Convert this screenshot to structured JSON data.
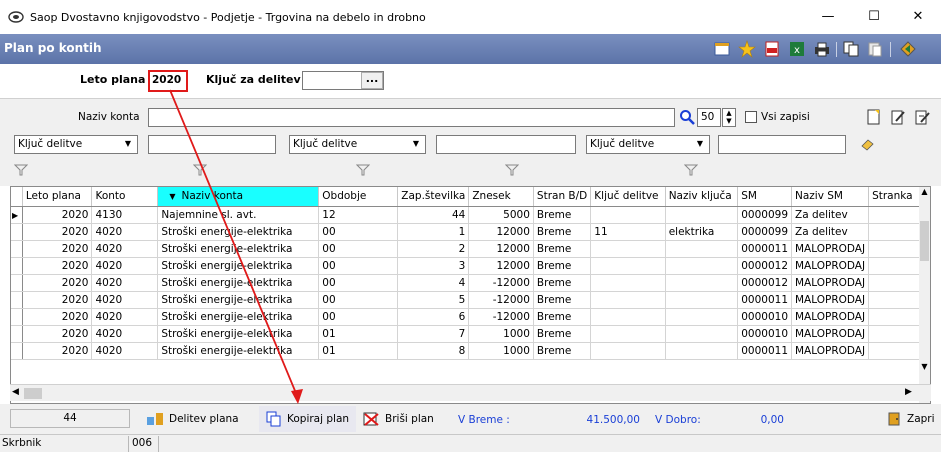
{
  "window": {
    "title": "Saop Dvostavno knjigovodstvo - Podjetje - Trgovina na debelo in drobno",
    "minimize": "—",
    "maximize": "☐",
    "close": "✕"
  },
  "header": {
    "title": "Plan po kontih"
  },
  "form": {
    "leto_plana_label": "Leto plana",
    "leto_plana_value": "2020",
    "kljuc_label": "Ključ za delitev",
    "kljuc_value": "",
    "ellipsis": "..."
  },
  "filter": {
    "naziv_konta_label": "Naziv konta",
    "naziv_konta_value": "",
    "count_value": "50",
    "vsi_zapisi_label": "Vsi zapisi",
    "kljuc1": "Ključ delitve",
    "kljuc2": "Ključ delitve",
    "kljuc3": "Ključ delitve"
  },
  "table": {
    "columns": [
      "Leto plana",
      "Konto",
      "Naziv konta",
      "Obdobje",
      "Zap.številka",
      "Znesek",
      "Stran B/D",
      "Ključ delitve",
      "Naziv ključa",
      "SM",
      "Naziv SM",
      "Stranka"
    ],
    "rows": [
      [
        "2020",
        "4130",
        "Najemnine sl. avt.",
        "12",
        "44",
        "5000",
        "Breme",
        "",
        "",
        "0000099",
        "Za delitev",
        ""
      ],
      [
        "2020",
        "4020",
        "Stroški energije-elektrika",
        "00",
        "1",
        "12000",
        "Breme",
        "11",
        "elektrika",
        "0000099",
        "Za delitev",
        ""
      ],
      [
        "2020",
        "4020",
        "Stroški energije-elektrika",
        "00",
        "2",
        "12000",
        "Breme",
        "",
        "",
        "0000011",
        "MALOPRODAJ",
        ""
      ],
      [
        "2020",
        "4020",
        "Stroški energije-elektrika",
        "00",
        "3",
        "12000",
        "Breme",
        "",
        "",
        "0000012",
        "MALOPRODAJ",
        ""
      ],
      [
        "2020",
        "4020",
        "Stroški energije-elektrika",
        "00",
        "4",
        "-12000",
        "Breme",
        "",
        "",
        "0000012",
        "MALOPRODAJ",
        ""
      ],
      [
        "2020",
        "4020",
        "Stroški energije-elektrika",
        "00",
        "5",
        "-12000",
        "Breme",
        "",
        "",
        "0000011",
        "MALOPRODAJ",
        ""
      ],
      [
        "2020",
        "4020",
        "Stroški energije-elektrika",
        "00",
        "6",
        "-12000",
        "Breme",
        "",
        "",
        "0000010",
        "MALOPRODAJ",
        ""
      ],
      [
        "2020",
        "4020",
        "Stroški energije-elektrika",
        "01",
        "7",
        "1000",
        "Breme",
        "",
        "",
        "0000010",
        "MALOPRODAJ",
        ""
      ],
      [
        "2020",
        "4020",
        "Stroški energije-elektrika",
        "01",
        "8",
        "1000",
        "Breme",
        "",
        "",
        "0000011",
        "MALOPRODAJ",
        ""
      ]
    ]
  },
  "bottom": {
    "count": "44",
    "delitev_plana": "Delitev plana",
    "kopiraj_plan": "Kopiraj plan",
    "brisi_plan": "Briši plan",
    "v_breme_label": "V Breme :",
    "v_breme_value": "41.500,00",
    "v_dobro_label": "V Dobro:",
    "v_dobro_value": "0,00",
    "zapri": "Zapri"
  },
  "status": {
    "label": "Skrbnik",
    "value": "006"
  },
  "colors": {
    "header_blue": "#6a80b4",
    "sorted_col": "#19ffff",
    "highlight_red": "#e01a1a",
    "link_blue": "#1a3fd6"
  }
}
